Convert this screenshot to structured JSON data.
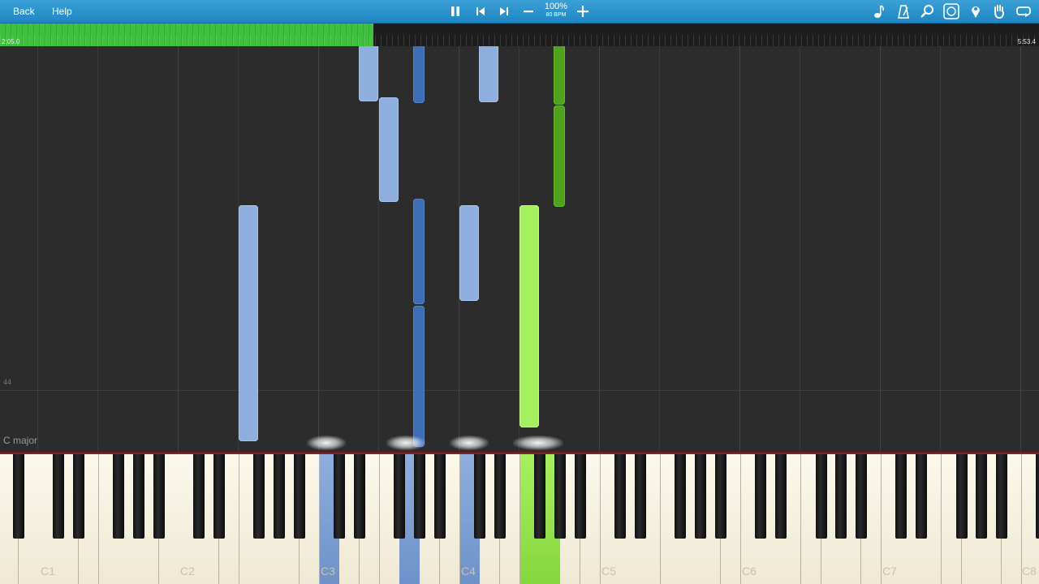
{
  "toolbar": {
    "back_label": "Back",
    "help_label": "Help",
    "zoom": "100%",
    "bpm": "80 BPM",
    "icons": [
      "pause-icon",
      "skip-back-icon",
      "skip-forward-icon",
      "zoom-minus-icon",
      "zoom-plus-icon",
      "note-icon",
      "metronome-icon",
      "search-icon",
      "display-icon",
      "pin-icon",
      "hand-icon",
      "loop-icon"
    ]
  },
  "progress": {
    "current": "2:05.0",
    "total": "5:53.4",
    "fraction": 0.359,
    "color": "#3fc13f"
  },
  "roll": {
    "measure_number": "44",
    "key_signature": "C major"
  },
  "keyboard": {
    "octave_labels": [
      "C1",
      "C2",
      "C3",
      "C4",
      "C5",
      "C6",
      "C7",
      "C8"
    ]
  },
  "colors": {
    "left_hand_light": "#8eaede",
    "left_hand_dark": "#3d6db5",
    "right_hand_light": "#a6f060",
    "right_hand_dark": "#4fa21e"
  }
}
